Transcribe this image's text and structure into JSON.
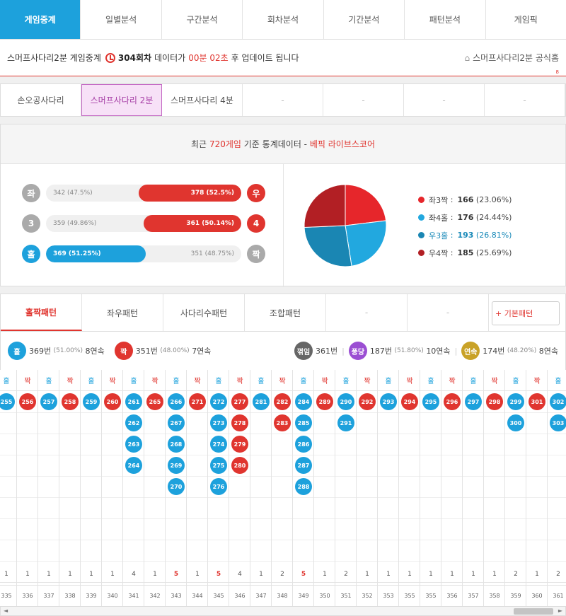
{
  "nav": {
    "tabs": [
      "게임중계",
      "일별분석",
      "구간분석",
      "회차분석",
      "기간분석",
      "패턴분석",
      "게임픽"
    ]
  },
  "info": {
    "prefix": "스머프사다리2분 게임중계",
    "round": "304회차",
    "mid": "데이터가",
    "time": "00분 02초",
    "suffix": "후 업데이트 됩니다",
    "home_link": "스머프사다리2분 공식홈",
    "corner": "8"
  },
  "subtabs": [
    "손오공사다리",
    "스머프사다리 2분",
    "스머프사다리 4분",
    "-",
    "-",
    "-",
    "-"
  ],
  "stats": {
    "head_pre": "최근",
    "head_num": "720게임",
    "head_mid": "기준 통계데이터 -",
    "head_brand": "베픽 라이브스코어",
    "rows": [
      {
        "left_icon": "좌",
        "right_icon": "우",
        "left_text": "342 (47.5%)",
        "right_text": "378 (52.5%)",
        "right_ratio": 0.525
      },
      {
        "left_icon": "3",
        "right_icon": "4",
        "left_text": "359 (49.86%)",
        "right_text": "361 (50.14%)",
        "right_ratio": 0.5014
      },
      {
        "left_icon": "홀",
        "right_icon": "짝",
        "left_text": "369 (51.25%)",
        "right_text": "351 (48.75%)",
        "left_ratio": 0.5125
      }
    ],
    "pie": [
      {
        "label": "좌3짝",
        "value": "166",
        "pct": "(23.06%)",
        "frac": 0.2306,
        "color": "#e6262b"
      },
      {
        "label": "좌4홀",
        "value": "176",
        "pct": "(24.44%)",
        "frac": 0.2444,
        "color": "#22a8df"
      },
      {
        "label": "우3홀",
        "value": "193",
        "pct": "(26.81%)",
        "frac": 0.2681,
        "color": "#1a86b3"
      },
      {
        "label": "우4짝",
        "value": "185",
        "pct": "(25.69%)",
        "frac": 0.2569,
        "color": "#b21f24"
      }
    ]
  },
  "ptabs": {
    "tabs": [
      "홀짝패턴",
      "좌우패턴",
      "사다리수패턴",
      "조합패턴",
      "-",
      "-"
    ],
    "basic": "+ 기본패턴"
  },
  "summary": {
    "odd": {
      "icon": "홀",
      "count": "369번",
      "pct": "(51.00%)",
      "streak": "8연속"
    },
    "even": {
      "icon": "짝",
      "count": "351번",
      "pct": "(48.00%)",
      "streak": "7연속"
    },
    "turn": {
      "icon": "꺾임",
      "count": "361번"
    },
    "pong": {
      "icon": "퐁당",
      "count": "187번",
      "pct": "(51.80%)",
      "streak": "10연속"
    },
    "cont": {
      "icon": "연속",
      "count": "174번",
      "pct": "(48.20%)",
      "streak": "8연속"
    }
  },
  "grid": {
    "cols": [
      {
        "h": "홀",
        "t": "odd",
        "balls": [
          "255"
        ],
        "c": "1",
        "r": "335"
      },
      {
        "h": "짝",
        "t": "even",
        "balls": [
          "256"
        ],
        "c": "1",
        "r": "336"
      },
      {
        "h": "홀",
        "t": "odd",
        "balls": [
          "257"
        ],
        "c": "1",
        "r": "337"
      },
      {
        "h": "짝",
        "t": "even",
        "balls": [
          "258"
        ],
        "c": "1",
        "r": "338"
      },
      {
        "h": "홀",
        "t": "odd",
        "balls": [
          "259"
        ],
        "c": "1",
        "r": "339"
      },
      {
        "h": "짝",
        "t": "even",
        "balls": [
          "260"
        ],
        "c": "1",
        "r": "340"
      },
      {
        "h": "홀",
        "t": "odd",
        "balls": [
          "261",
          "262",
          "263",
          "264"
        ],
        "c": "4",
        "r": "341"
      },
      {
        "h": "짝",
        "t": "even",
        "balls": [
          "265"
        ],
        "c": "1",
        "r": "342"
      },
      {
        "h": "홀",
        "t": "odd",
        "balls": [
          "266",
          "267",
          "268",
          "269",
          "270"
        ],
        "c": "5",
        "r": "343"
      },
      {
        "h": "짝",
        "t": "even",
        "balls": [
          "271"
        ],
        "c": "1",
        "r": "344"
      },
      {
        "h": "홀",
        "t": "odd",
        "balls": [
          "272",
          "273",
          "274",
          "275",
          "276"
        ],
        "c": "5",
        "r": "345"
      },
      {
        "h": "짝",
        "t": "even",
        "balls": [
          "277",
          "278",
          "279",
          "280"
        ],
        "c": "4",
        "r": "346"
      },
      {
        "h": "홀",
        "t": "odd",
        "balls": [
          "281"
        ],
        "c": "1",
        "r": "347"
      },
      {
        "h": "짝",
        "t": "even",
        "balls": [
          "282",
          "283"
        ],
        "c": "2",
        "r": "348"
      },
      {
        "h": "홀",
        "t": "odd",
        "balls": [
          "284",
          "285",
          "286",
          "287",
          "288"
        ],
        "c": "5",
        "r": "349"
      },
      {
        "h": "짝",
        "t": "even",
        "balls": [
          "289"
        ],
        "c": "1",
        "r": "350"
      },
      {
        "h": "홀",
        "t": "odd",
        "balls": [
          "290",
          "291"
        ],
        "c": "2",
        "r": "351"
      },
      {
        "h": "짝",
        "t": "even",
        "balls": [
          "292"
        ],
        "c": "1",
        "r": "352"
      },
      {
        "h": "홀",
        "t": "odd",
        "balls": [
          "293"
        ],
        "c": "1",
        "r": "353"
      },
      {
        "h": "짝",
        "t": "even",
        "balls": [
          "294"
        ],
        "c": "1",
        "r": "355"
      },
      {
        "h": "홀",
        "t": "odd",
        "balls": [
          "295"
        ],
        "c": "1",
        "r": "355"
      },
      {
        "h": "짝",
        "t": "even",
        "balls": [
          "296"
        ],
        "c": "1",
        "r": "356"
      },
      {
        "h": "홀",
        "t": "odd",
        "balls": [
          "297"
        ],
        "c": "1",
        "r": "357"
      },
      {
        "h": "짝",
        "t": "even",
        "balls": [
          "298"
        ],
        "c": "1",
        "r": "358"
      },
      {
        "h": "홀",
        "t": "odd",
        "balls": [
          "299",
          "300"
        ],
        "c": "2",
        "r": "359"
      },
      {
        "h": "짝",
        "t": "even",
        "balls": [
          "301"
        ],
        "c": "1",
        "r": "360"
      },
      {
        "h": "홀",
        "t": "odd",
        "balls": [
          "302",
          "303"
        ],
        "c": "2",
        "r": "361"
      }
    ]
  },
  "scroll": {
    "left": "◄",
    "right": "►"
  }
}
